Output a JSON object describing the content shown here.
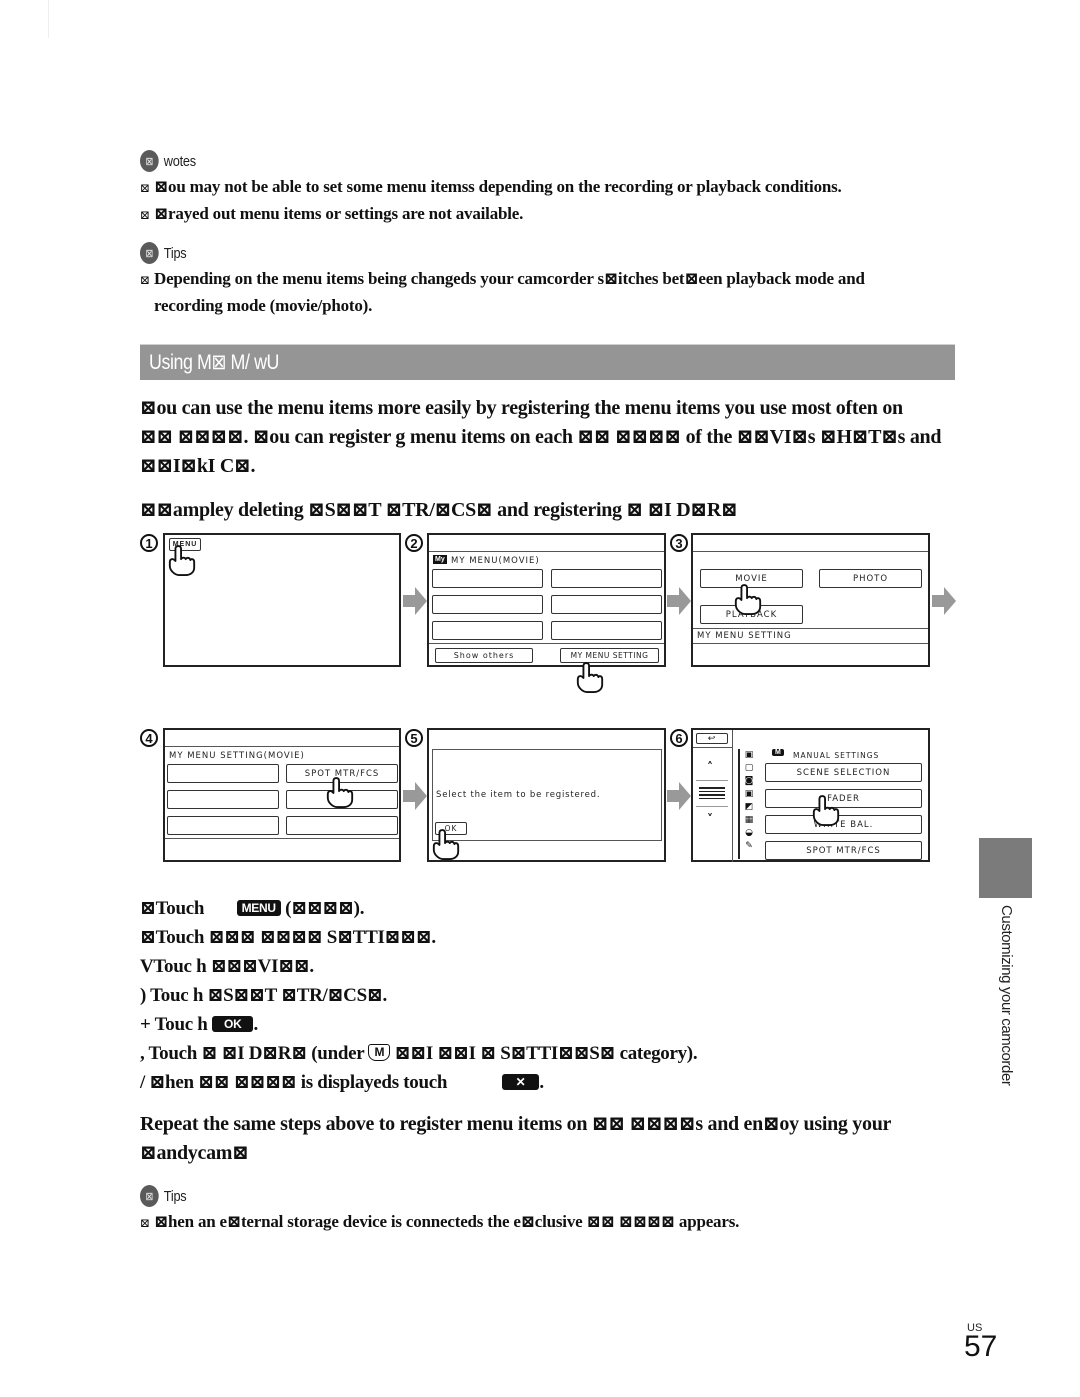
{
  "notes": {
    "heading": "wotes",
    "badge": "⊠",
    "items": [
      "⊠ou may not be able to set some menu itemss  depending on the recording or playback conditions.",
      "⊠rayed out menu items or settings are not available."
    ]
  },
  "tips1": {
    "heading": "Tips",
    "badge": "⊠",
    "items": [
      "Depending on the menu items being changeds  your camcorder s⊠itches bet⊠een playback mode and",
      "recording mode (movie/photo)."
    ]
  },
  "section": {
    "title": "Using M⊠ M/ wU"
  },
  "intro": {
    "lines": [
      "⊠ou can use the menu items more easily by registering the menu items you use most often on",
      "⊠⊠ ⊠⊠⊠⊠. ⊠ou can register g menu items on each ⊠⊠ ⊠⊠⊠⊠ of the ⊠⊠VI⊠s  ⊠H⊠T⊠s  and",
      "⊠⊠I⊠kI C⊠."
    ],
    "example": "⊠⊠ampley deleting ⊠S⊠⊠T ⊠TR/⊠CS⊠ and registering ⊠   ⊠I D⊠R⊠"
  },
  "screens": {
    "s1": {
      "num": "1",
      "menu_btn": "MENU"
    },
    "s2": {
      "num": "2",
      "my_badge": "My",
      "title": "MY MENU(MOVIE)",
      "show_others": "Show others",
      "setting": "MY MENU SETTING"
    },
    "s3": {
      "num": "3",
      "movie": "MOVIE",
      "photo": "PHOTO",
      "playback": "PLAYBACK",
      "footer": "MY MENU SETTING"
    },
    "s4": {
      "num": "4",
      "title": "MY MENU SETTING(MOVIE)",
      "item": "SPOT MTR/FCS"
    },
    "s5": {
      "num": "5",
      "message": "Select the item to be registered.",
      "ok": "OK"
    },
    "s6": {
      "num": "6",
      "back": "↩",
      "up": "˄",
      "down": "˅",
      "m_badge": "M",
      "category": "MANUAL SETTINGS",
      "items": [
        "SCENE SELECTION",
        "FADER",
        "WHITE BAL.",
        "SPOT MTR/FCS"
      ]
    }
  },
  "steps": [
    {
      "prefix": "⊠Touch ",
      "pill": "MENU",
      "suffix": " (⊠⊠⊠⊠)."
    },
    {
      "prefix": "⊠Touch ⊠⊠⊠ ⊠⊠⊠⊠ S⊠TTI⊠⊠⊠."
    },
    {
      "prefix": "VTouc  h ⊠⊠⊠VI⊠⊠."
    },
    {
      "prefix": ") Touc  h ⊠S⊠⊠T ⊠TR/⊠CS⊠."
    },
    {
      "prefix": "+ Touc  h ",
      "pill": "OK",
      "suffix": "."
    },
    {
      "prefix": ", Touch ⊠        ⊠I D⊠R⊠ (under ",
      "mcat": "M",
      "suffix": " ⊠⊠I ⊠⊠I ⊠ S⊠TTI⊠⊠S⊠ category)."
    },
    {
      "prefix": "/ ⊠hen ⊠⊠ ⊠⊠⊠⊠ is displayeds  touch ",
      "pill": "✕",
      "suffix": "."
    }
  ],
  "repeat": {
    "lines": [
      "Repeat the same steps above to register menu items on ⊠⊠ ⊠⊠⊠⊠s  and en⊠oy using your",
      "⊠andycam⊠"
    ]
  },
  "tips2": {
    "heading": "Tips",
    "badge": "⊠",
    "items": [
      "⊠hen an e⊠ternal storage device is connecteds  the e⊠clusive ⊠⊠ ⊠⊠⊠⊠ appears."
    ]
  },
  "sidebar": {
    "label": "Customizing your camcorder"
  },
  "footer": {
    "region": "US",
    "page": "57"
  },
  "colors": {
    "section_bar": "#959595",
    "side_tab": "#7b7b7b",
    "arrow": "#999999"
  }
}
